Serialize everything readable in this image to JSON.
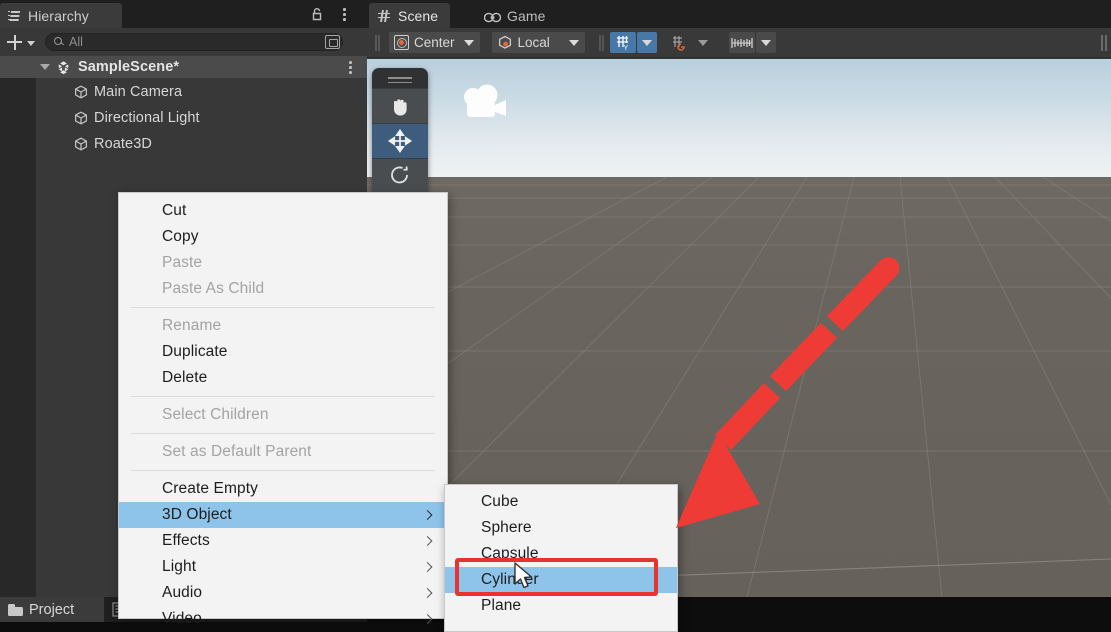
{
  "hierarchy": {
    "tab_label": "Hierarchy",
    "tab_icon": "hierarchy-list-icon",
    "lock_icon": "lock-open-icon",
    "kebab_icon": "kebab-menu-icon",
    "add_button_label": "+",
    "search_placeholder": "All",
    "search_icon": "search-icon",
    "scene": {
      "name": "SampleScene*",
      "expanded": true,
      "icon": "unity-scene-icon"
    },
    "objects": [
      {
        "name": "Main Camera",
        "icon": "gameobject-cube-icon"
      },
      {
        "name": "Directional Light",
        "icon": "gameobject-cube-icon"
      },
      {
        "name": "Roate3D",
        "icon": "gameobject-cube-icon"
      }
    ]
  },
  "scene_view": {
    "tabs": [
      {
        "label": "Scene",
        "icon": "grid-hash-icon",
        "active": true
      },
      {
        "label": "Game",
        "icon": "gamepad-icon",
        "active": false
      }
    ],
    "toolbar": {
      "pivot_mode": "Center",
      "pivot_icon": "pivot-center-icon",
      "handle_space": "Local",
      "handle_icon": "local-cube-icon",
      "grid_toggle_icon": "grid-y-axis-icon",
      "grid_toggle_active": true,
      "snap_icon": "grid-snap-icon",
      "snap_active": false,
      "ruler_icon": "ruler-scale-icon",
      "ruler_active": false
    },
    "tool_palette": [
      {
        "icon": "hand-tool-icon",
        "selected": false
      },
      {
        "icon": "move-tool-icon",
        "selected": true
      },
      {
        "icon": "rotate-tool-icon",
        "selected": false
      },
      {
        "icon": "scale-tool-icon",
        "selected": false
      }
    ],
    "gizmos": [
      {
        "icon": "camera-gizmo-icon"
      }
    ]
  },
  "context_menu": {
    "items": [
      {
        "label": "Cut",
        "enabled": true,
        "submenu": false,
        "highlighted": false
      },
      {
        "label": "Copy",
        "enabled": true,
        "submenu": false,
        "highlighted": false
      },
      {
        "label": "Paste",
        "enabled": false,
        "submenu": false,
        "highlighted": false
      },
      {
        "label": "Paste As Child",
        "enabled": false,
        "submenu": false,
        "highlighted": false
      },
      {
        "separator": true
      },
      {
        "label": "Rename",
        "enabled": false,
        "submenu": false,
        "highlighted": false
      },
      {
        "label": "Duplicate",
        "enabled": true,
        "submenu": false,
        "highlighted": false
      },
      {
        "label": "Delete",
        "enabled": true,
        "submenu": false,
        "highlighted": false
      },
      {
        "separator": true
      },
      {
        "label": "Select Children",
        "enabled": false,
        "submenu": false,
        "highlighted": false
      },
      {
        "separator": true
      },
      {
        "label": "Set as Default Parent",
        "enabled": false,
        "submenu": false,
        "highlighted": false
      },
      {
        "separator": true
      },
      {
        "label": "Create Empty",
        "enabled": true,
        "submenu": false,
        "highlighted": false
      },
      {
        "label": "3D Object",
        "enabled": true,
        "submenu": true,
        "highlighted": true
      },
      {
        "label": "Effects",
        "enabled": true,
        "submenu": true,
        "highlighted": false
      },
      {
        "label": "Light",
        "enabled": true,
        "submenu": true,
        "highlighted": false
      },
      {
        "label": "Audio",
        "enabled": true,
        "submenu": true,
        "highlighted": false
      },
      {
        "label": "Video",
        "enabled": true,
        "submenu": true,
        "highlighted": false
      }
    ]
  },
  "submenu": {
    "parent": "3D Object",
    "items": [
      {
        "label": "Cube",
        "highlighted": false
      },
      {
        "label": "Sphere",
        "highlighted": false
      },
      {
        "label": "Capsule",
        "highlighted": false
      },
      {
        "label": "Cylinder",
        "highlighted": true
      },
      {
        "label": "Plane",
        "highlighted": false
      }
    ]
  },
  "annotations": {
    "arrow": {
      "color": "#ef3b36",
      "style": "dashed-arrow",
      "points_to": "Cylinder"
    },
    "highlight_box": {
      "color": "#e8332e",
      "target": "Cylinder"
    },
    "cursor": {
      "icon": "mouse-pointer-icon",
      "over": "Cylinder"
    }
  },
  "bottom": {
    "project_tab": "Project",
    "project_icon": "folder-icon",
    "console_icon": "console-list-icon"
  },
  "colors": {
    "panel_bg": "#383838",
    "tabbar_bg": "#1f1f1f",
    "menu_bg": "#f3f3f3",
    "menu_highlight": "#8ec4ea",
    "accent_blue": "#4878a8",
    "annotation_red": "#ef3b36"
  }
}
